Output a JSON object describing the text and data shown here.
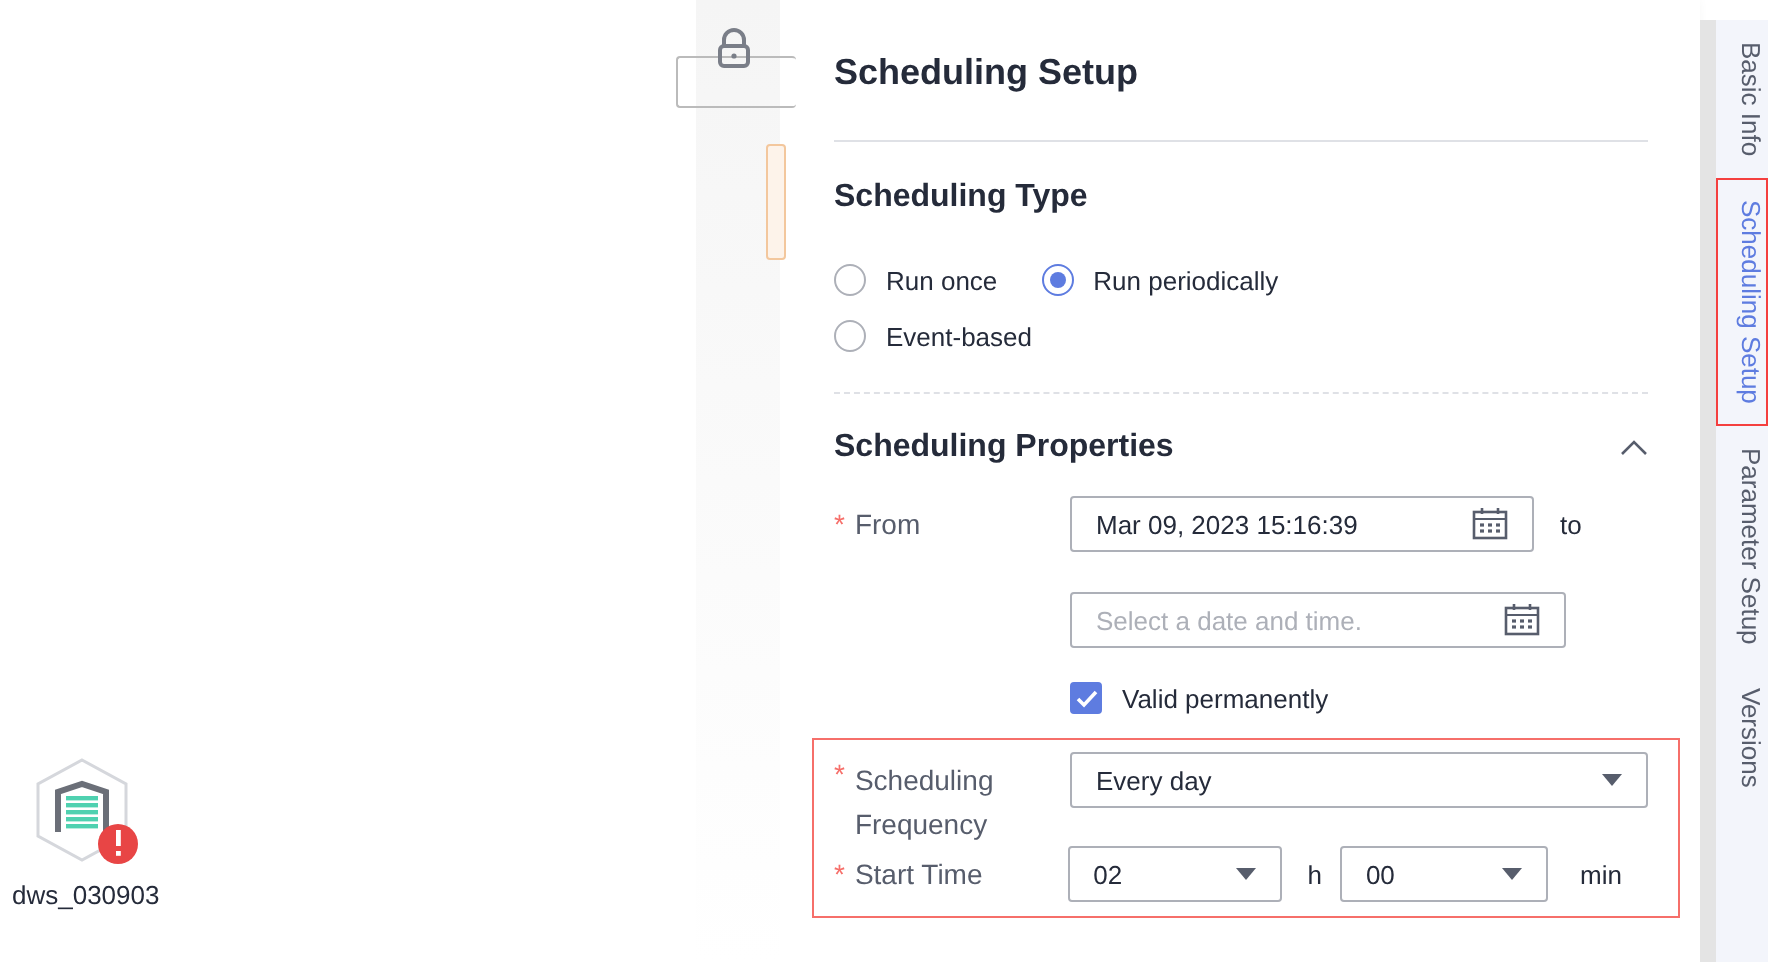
{
  "canvas": {
    "node": {
      "label": "dws_030903",
      "error": true
    }
  },
  "panel": {
    "title": "Scheduling Setup",
    "scheduling_type": {
      "heading": "Scheduling Type",
      "options": [
        {
          "label": "Run once",
          "selected": false
        },
        {
          "label": "Run periodically",
          "selected": true
        },
        {
          "label": "Event-based",
          "selected": false
        }
      ]
    },
    "properties": {
      "heading": "Scheduling Properties",
      "expanded": true,
      "from": {
        "label": "From",
        "required_mark": "*",
        "value": "Mar 09, 2023 15:16:39",
        "to": "to",
        "end_placeholder": "Select a date and time."
      },
      "valid_permanently": {
        "label": "Valid permanently",
        "checked": true
      },
      "frequency": {
        "label": "Scheduling Frequency",
        "required_mark": "*",
        "value": "Every day"
      },
      "start_time": {
        "label": "Start Time",
        "required_mark": "*",
        "hour": "02",
        "hour_unit": "h",
        "minute": "00",
        "minute_unit": "min"
      }
    }
  },
  "side_tabs": [
    {
      "label": "Basic Info",
      "selected": false
    },
    {
      "label": "Scheduling Setup",
      "selected": true
    },
    {
      "label": "Parameter Setup",
      "selected": false
    },
    {
      "label": "Versions",
      "selected": false
    }
  ]
}
